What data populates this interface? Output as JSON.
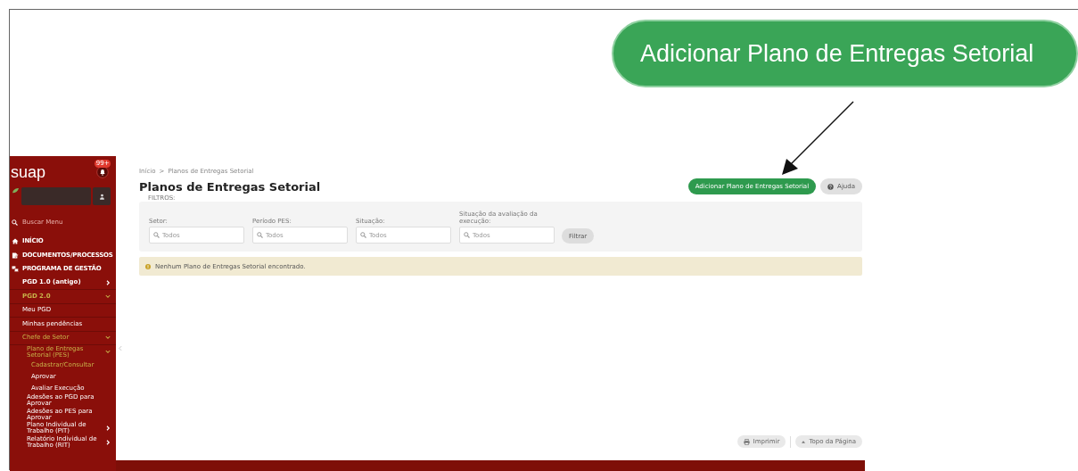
{
  "callout": {
    "label": "Adicionar Plano de Entregas Setorial"
  },
  "sidebar": {
    "logo": "suap",
    "notification_badge": "99+",
    "search": {
      "placeholder": "Buscar Menu"
    },
    "items": [
      {
        "label": "INÍCIO",
        "selected": false
      },
      {
        "label": "DOCUMENTOS/PROCESSOS",
        "selected": false
      },
      {
        "label": "PROGRAMA DE GESTÃO",
        "selected": false,
        "children": [
          {
            "label": "PGD 1.0 (antigo)",
            "selected": false,
            "expanded": false
          },
          {
            "label": "PGD 2.0",
            "selected": true,
            "expanded": true,
            "children": [
              {
                "label": "Meu PGD",
                "selected": false
              },
              {
                "label": "Minhas pendências",
                "selected": false
              },
              {
                "label": "Chefe de Setor",
                "selected": true,
                "expanded": true,
                "children": [
                  {
                    "label": "Plano de Entregas Setorial (PES)",
                    "selected": true,
                    "expanded": true,
                    "children": [
                      {
                        "label": "Cadastrar/Consultar",
                        "selected": true
                      },
                      {
                        "label": "Aprovar",
                        "selected": false
                      },
                      {
                        "label": "Avaliar Execução",
                        "selected": false
                      }
                    ]
                  },
                  {
                    "label": "Adesões ao PGD para Aprovar",
                    "selected": false
                  },
                  {
                    "label": "Adesões ao PES para Aprovar",
                    "selected": false
                  },
                  {
                    "label": "Plano Individual de Trabalho (PIT)",
                    "selected": false,
                    "expanded": false
                  },
                  {
                    "label": "Relatório Individual de Trabalho (RIT)",
                    "selected": false,
                    "expanded": false
                  }
                ]
              }
            ]
          }
        ]
      }
    ]
  },
  "breadcrumb": {
    "separator": ">",
    "items": [
      "Início",
      "Planos de Entregas Setorial"
    ]
  },
  "title": "Planos de Entregas Setorial",
  "actions": [
    {
      "label": "Adicionar Plano de Entregas Setorial",
      "kind": "primary"
    },
    {
      "label": "Ajuda",
      "kind": "help"
    }
  ],
  "filters": {
    "legend": "FILTROS:",
    "fields": [
      {
        "label": "Setor:",
        "placeholder": "Todos"
      },
      {
        "label": "Período PES:",
        "placeholder": "Todos"
      },
      {
        "label": "Situação:",
        "placeholder": "Todos"
      },
      {
        "label": "Situação da avaliação da execução:",
        "placeholder": "Todos"
      }
    ],
    "button": "Filtrar"
  },
  "alert": "Nenhum Plano de Entregas Setorial encontrado.",
  "footer_buttons": [
    {
      "label": "Imprimir",
      "kind": "print"
    },
    {
      "label": "Topo da Página",
      "kind": "top"
    }
  ]
}
